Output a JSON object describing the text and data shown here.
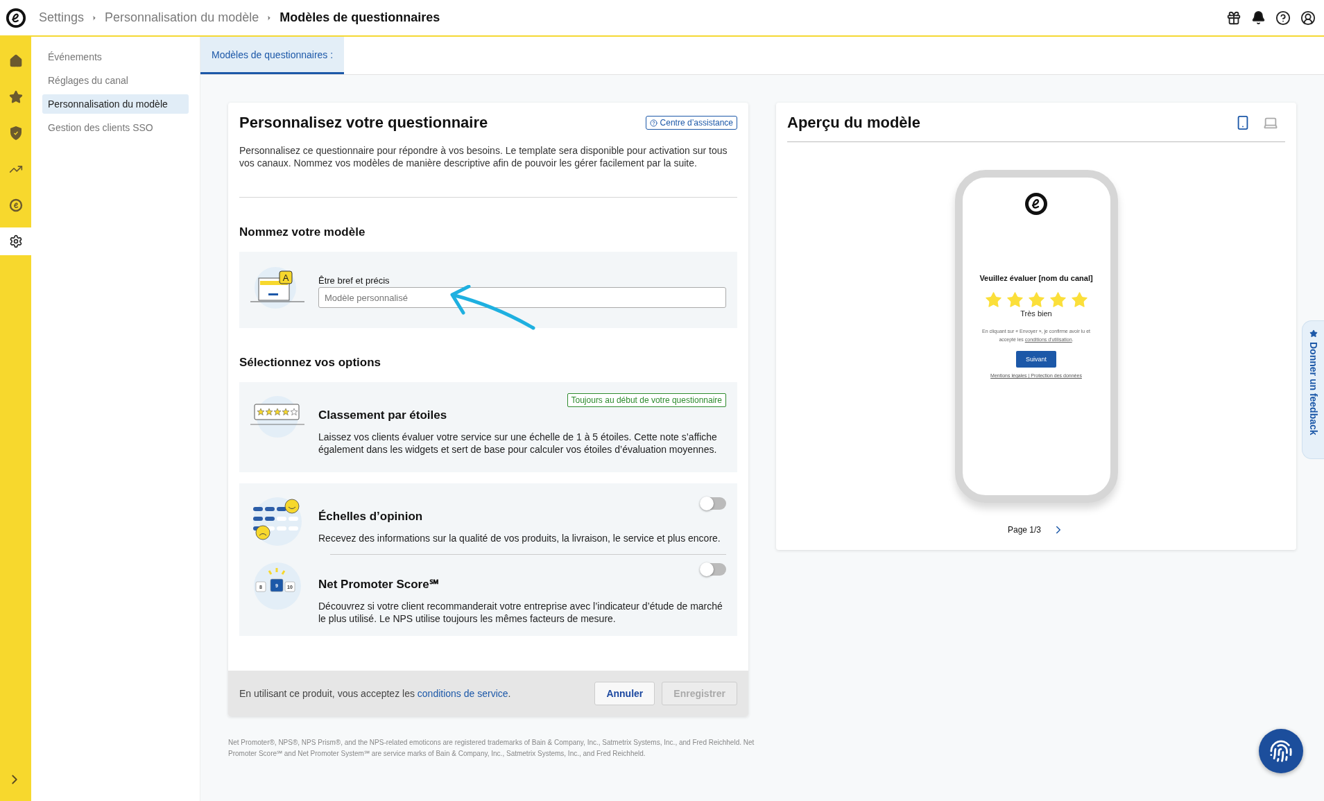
{
  "topbar": {
    "breadcrumbs": [
      {
        "label": "Settings",
        "current": false
      },
      {
        "label": "Personnalisation du modèle",
        "current": false
      },
      {
        "label": "Modèles de questionnaires",
        "current": true
      }
    ]
  },
  "rail": {
    "items": [
      {
        "kind": "home",
        "selected": false
      },
      {
        "kind": "star",
        "selected": false
      },
      {
        "kind": "shield",
        "selected": false
      },
      {
        "kind": "chart",
        "selected": false
      },
      {
        "kind": "brand",
        "selected": false
      },
      {
        "kind": "settings",
        "selected": true
      }
    ]
  },
  "sidebar": {
    "items": [
      {
        "label": "Événements",
        "selected": false
      },
      {
        "label": "Réglages du canal",
        "selected": false
      },
      {
        "label": "Personnalisation du modèle",
        "selected": true
      },
      {
        "label": "Gestion des clients SSO",
        "selected": false
      }
    ]
  },
  "tabs": [
    {
      "label": "Modèles de questionnaires :",
      "selected": true
    }
  ],
  "editor": {
    "title": "Personnalisez votre questionnaire",
    "help_link": "Centre d’assistance",
    "intro": "Personnalisez ce questionnaire pour répondre à vos besoins. Le template sera disponible pour activation sur tous vos canaux. Nommez vos modèles de manière descriptive afin de pouvoir les gérer facilement par la suite.",
    "name_section": {
      "heading": "Nommez votre modèle",
      "badge_letter": "A",
      "field_label": "Être bref et précis",
      "placeholder": "Modèle personnalisé"
    },
    "options_heading": "Sélectionnez vos options",
    "option_groups": [
      {
        "options": [
          {
            "kind": "fixed",
            "illustration": {
              "kind": "stars"
            },
            "title": "Classement par étoiles",
            "badge": "Toujours au début de votre questionnaire",
            "description": "Laissez vos clients évaluer votre service sur une échelle de 1 à 5 étoiles. Cette note s’affiche également dans les widgets et sert de base pour calculer vos étoiles d’évaluation moyennes."
          }
        ]
      },
      {
        "options": [
          {
            "kind": "toggle",
            "illustration": {
              "kind": "opinion"
            },
            "title": "Échelles d’opinion",
            "on": false,
            "description": "Recevez des informations sur la qualité de vos produits, la livraison, le service et plus encore."
          },
          {
            "kind": "toggle",
            "illustration": {
              "kind": "nps"
            },
            "title": "Net Promoter Score℠",
            "on": false,
            "scale": [
              {
                "label": "8",
                "selected": false
              },
              {
                "label": "9",
                "selected": true
              },
              {
                "label": "10",
                "selected": false
              }
            ],
            "description": "Découvrez si votre client recommanderait votre entreprise avec l’indicateur d’étude de marché le plus utilisé. Le NPS utilise toujours les mêmes facteurs de mesure."
          }
        ]
      }
    ],
    "footer": {
      "text": "En utilisant ce produit, vous acceptez les ",
      "link": "conditions de service",
      "end": ".",
      "buttons": [
        {
          "label": "Annuler",
          "disabled": false
        },
        {
          "label": "Enregistrer",
          "disabled": true
        }
      ]
    }
  },
  "legal": "Net Promoter®, NPS®, NPS Prism®, and the NPS-related emoticons are registered trademarks of Bain & Company, Inc., Satmetrix Systems, Inc., and Fred Reichheld. Net Promoter Score℠ and Net Promoter System℠ are service marks of Bain & Company, Inc., Satmetrix Systems, Inc., and Fred Reichheld.",
  "preview": {
    "title": "Aperçu du modèle",
    "devices": [
      {
        "kind": "mobile",
        "selected": true
      },
      {
        "kind": "desktop",
        "selected": false
      }
    ],
    "phone": {
      "question": "Veuillez évaluer [nom du canal]",
      "stars": 5,
      "rating_label": "Très bien",
      "consent_text": "En cliquant sur « Envoyer », je confirme avoir lu et accepté les ",
      "consent_link": "conditions d'utilisation",
      "consent_end": ".",
      "button": "Suivant",
      "footer_links": "Mentions légales | Protection des données"
    },
    "pager": "Page 1/3"
  },
  "feedback": {
    "label": "Donner un feedback"
  }
}
